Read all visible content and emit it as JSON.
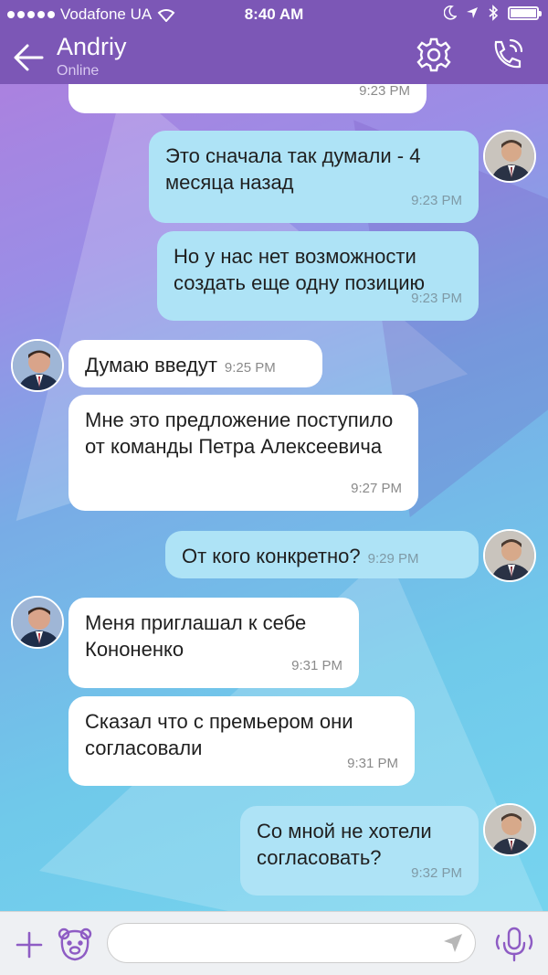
{
  "status_bar": {
    "carrier": "Vodafone UA",
    "time": "8:40 AM"
  },
  "header": {
    "contact_name": "Andriy",
    "contact_status": "Online"
  },
  "messages": [
    {
      "direction": "in",
      "text": "",
      "time": "9:23 PM"
    },
    {
      "direction": "out",
      "text": "Это сначала так думали - 4 месяца назад",
      "time": "9:23 PM"
    },
    {
      "direction": "out",
      "text": "Но у нас нет возможности создать еще одну позицию",
      "time": "9:23 PM"
    },
    {
      "direction": "in",
      "text": "Думаю введут",
      "time": "9:25 PM"
    },
    {
      "direction": "in",
      "text": "Мне это предложение поступило от команды Петра Алексеевича",
      "time": "9:27 PM"
    },
    {
      "direction": "out",
      "text": "От кого конкретно?",
      "time": "9:29 PM"
    },
    {
      "direction": "in",
      "text": "Меня приглашал к себе Кононенко",
      "time": "9:31 PM"
    },
    {
      "direction": "in",
      "text": "Сказал что с премьером они согласовали",
      "time": "9:31 PM"
    },
    {
      "direction": "out",
      "text": "Со мной не хотели согласовать?",
      "time": "9:32 PM"
    }
  ],
  "composer": {
    "placeholder": ""
  },
  "colors": {
    "header": "#7c57b6",
    "outgoing_bubble": "#aee3f6",
    "incoming_bubble": "#ffffff",
    "accent": "#8e5cc4"
  },
  "icons": {
    "back": "back-arrow-icon",
    "settings": "gear-icon",
    "call": "phone-call-icon",
    "add": "plus-icon",
    "sticker": "bear-sticker-icon",
    "send": "send-arrow-icon",
    "voice": "microphone-icon"
  }
}
